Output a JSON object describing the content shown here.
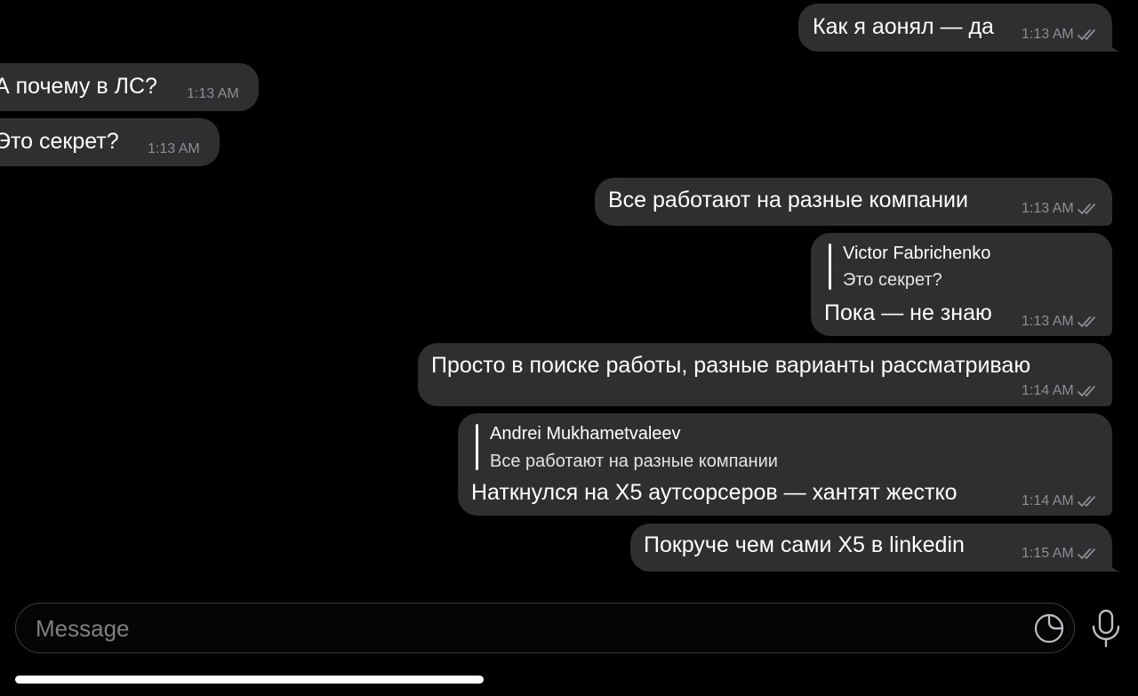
{
  "messages": [
    {
      "text": "Как я аонял — да",
      "time": "1:13 AM"
    },
    {
      "text": "А почему в ЛС?",
      "time": "1:13 AM"
    },
    {
      "text": "Это секрет?",
      "time": "1:13 AM"
    },
    {
      "text": "Все работают на разные компании",
      "time": "1:13 AM"
    },
    {
      "reply_name": "Victor Fabrichenko",
      "reply_text": "Это секрет?",
      "text": "Пока — не знаю",
      "time": "1:13 AM"
    },
    {
      "text": "Просто в поиске работы, разные варианты рассматриваю",
      "time": "1:14 AM"
    },
    {
      "reply_name": "Andrei Mukhametvaleev",
      "reply_text": "Все работают на разные компании",
      "text": "Наткнулся на X5 аутсорсеров — хантят жестко",
      "time": "1:14 AM"
    },
    {
      "text": "Покруче чем сами X5  в linkedin",
      "time": "1:15 AM"
    }
  ],
  "composer": {
    "placeholder": "Message"
  },
  "icons": {
    "sticker": "sticker-icon",
    "mic": "microphone-icon",
    "read": "double-check-icon"
  },
  "colors": {
    "background": "#000000",
    "bubble": "#2f2f31",
    "meta": "#8d8d92"
  }
}
